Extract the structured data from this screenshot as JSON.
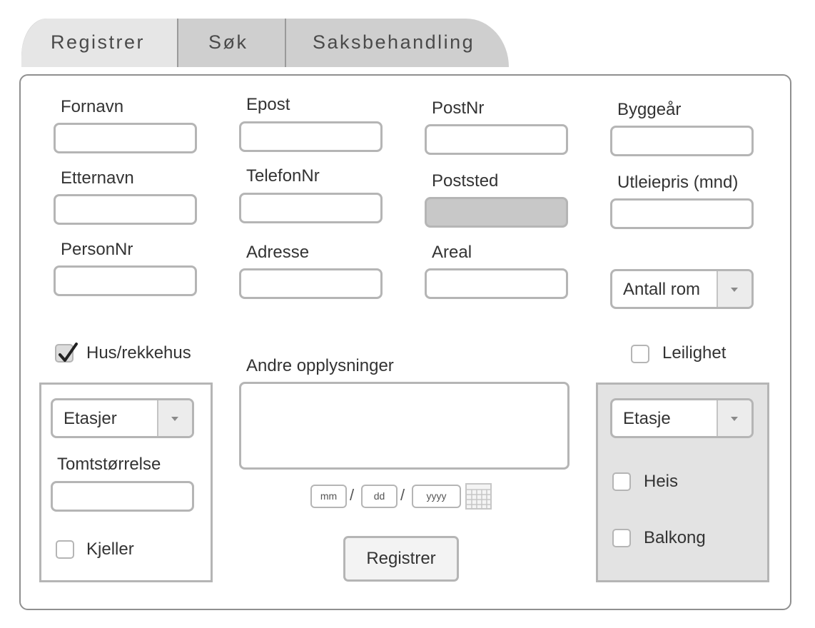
{
  "tabs": [
    {
      "label": "Registrer",
      "active": true
    },
    {
      "label": "Søk",
      "active": false
    },
    {
      "label": "Saksbehandling",
      "active": false
    }
  ],
  "form": {
    "fornavn_label": "Fornavn",
    "etternavn_label": "Etternavn",
    "personnr_label": "PersonNr",
    "epost_label": "Epost",
    "telefonnr_label": "TelefonNr",
    "adresse_label": "Adresse",
    "postnr_label": "PostNr",
    "poststed_label": "Poststed",
    "areal_label": "Areal",
    "byggeaar_label": "Byggeår",
    "utleiepris_label": "Utleiepris (mnd)",
    "antall_rom_selected": "Antall rom",
    "andre_opplysninger_label": "Andre opplysninger",
    "date": {
      "mm": "mm",
      "dd": "dd",
      "yyyy": "yyyy",
      "separator": "/"
    },
    "submit_label": "Registrer"
  },
  "house_section": {
    "checkbox_label": "Hus/rekkehus",
    "checked": true,
    "etasjer_selected": "Etasjer",
    "tomtstorrelse_label": "Tomtstørrelse",
    "kjeller_label": "Kjeller"
  },
  "apartment_section": {
    "checkbox_label": "Leilighet",
    "checked": false,
    "etasje_selected": "Etasje",
    "heis_label": "Heis",
    "balkong_label": "Balkong"
  },
  "colors": {
    "tab_active": "#e6e6e6",
    "tab_inactive": "#cfcfcf",
    "disabled_field": "#c8c8c8",
    "apartment_panel": "#e3e3e3",
    "border": "#b5b5b5"
  }
}
